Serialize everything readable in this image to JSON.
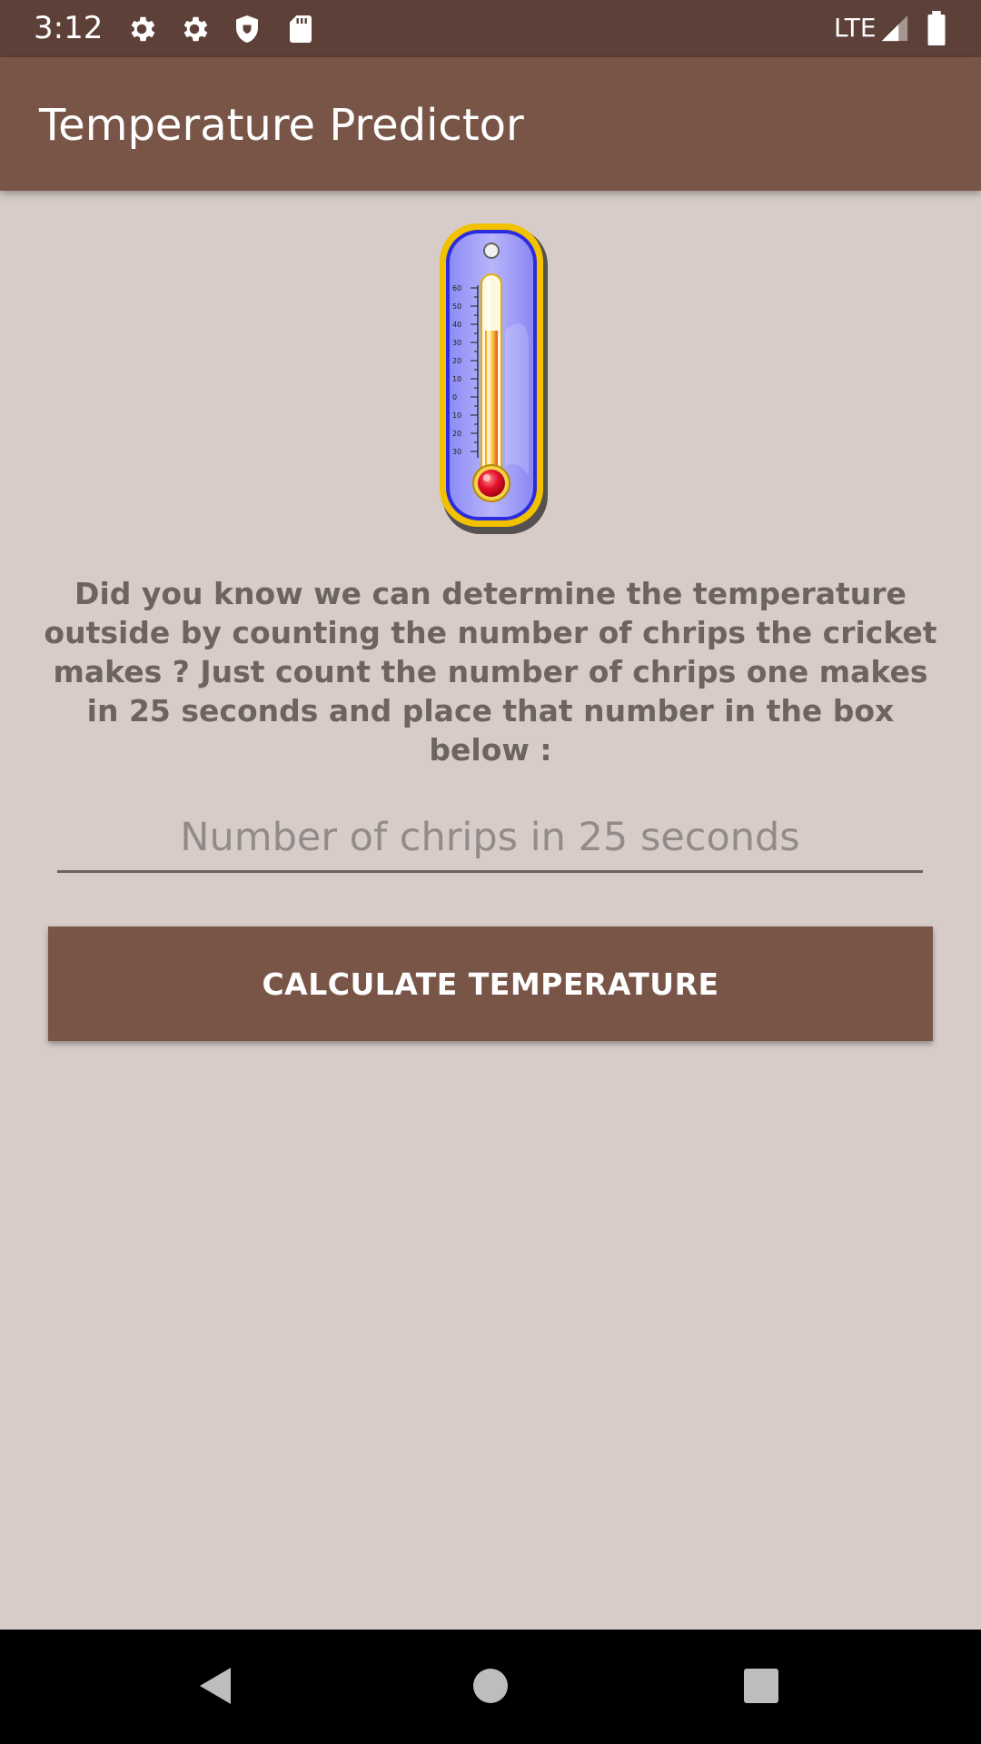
{
  "status_bar": {
    "time": "3:12",
    "icons": [
      "settings-icon",
      "settings-icon",
      "shield-icon",
      "sd-card-icon"
    ],
    "network": "LTE"
  },
  "app_bar": {
    "title": "Temperature Predictor"
  },
  "content": {
    "image": "thermometer-image",
    "description": "Did you know we can determine the temperature outside by counting the number of chrips the cricket makes ? Just count the number of chrips one makes in 25 seconds and place that number in the box below :",
    "input_placeholder": "Number of chrips in 25 seconds",
    "input_value": "",
    "button_label": "CALCULATE TEMPERATURE"
  },
  "thermometer_scale": [
    "60",
    "50",
    "40",
    "30",
    "20",
    "10",
    "0",
    "10",
    "20",
    "30"
  ],
  "nav_bar": {
    "buttons": [
      "back-icon",
      "home-icon",
      "recents-icon"
    ]
  },
  "colors": {
    "status_bar": "#5d4037",
    "primary": "#795548",
    "background": "#d7ccc8",
    "text_secondary": "#6d6360"
  }
}
